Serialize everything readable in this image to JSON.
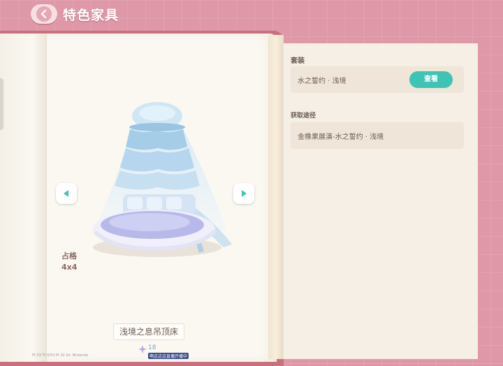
{
  "header": {
    "title": "特色家具",
    "back_icon": "chevron-left-icon"
  },
  "left_page": {
    "prev_icon": "caret-left-icon",
    "next_icon": "caret-right-icon",
    "size_label": "占格",
    "size_value": "4x4",
    "item_name": "浅境之息吊顶床",
    "hud": "Pt 53   Tt 0/53   Pt 32   Gt: Nintendo",
    "live_count": "18",
    "live_text": "啊这这这直播开播中"
  },
  "right_page": {
    "set_title": "套装",
    "set_name": "水之誓约 · 浅境",
    "view_button": "查看",
    "source_title": "获取途径",
    "source_text": "金橡果展演-水之誓约 · 浅境"
  },
  "colors": {
    "background": "#df98a8",
    "accent": "#3ec4b4",
    "text": "#6b5a52"
  }
}
